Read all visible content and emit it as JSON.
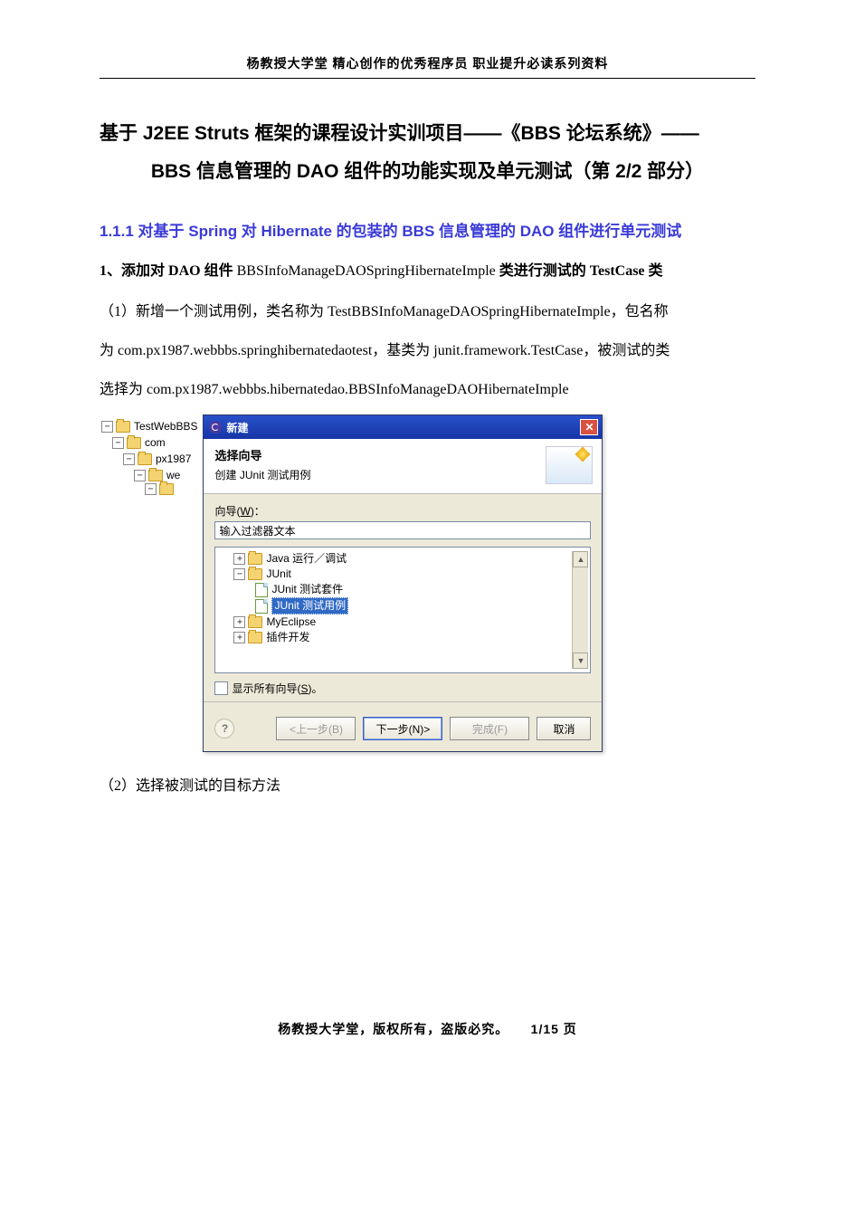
{
  "header": "杨教授大学堂 精心创作的优秀程序员 职业提升必读系列资料",
  "title_line1": "基于 J2EE Struts 框架的课程设计实训项目——《BBS 论坛系统》——",
  "title_line2": "BBS 信息管理的 DAO 组件的功能实现及单元测试（第 2/2 部分）",
  "section_1_1_1": "1.1.1 对基于 Spring 对 Hibernate 的包装的 BBS 信息管理的 DAO 组件进行单元测试",
  "sub1_prefix": "1、添加对 ",
  "sub1_bold1": "DAO",
  "sub1_mid1": " 组件 ",
  "sub1_cls": "BBSInfoManageDAOSpringHibernateImple",
  "sub1_mid2": " 类进行测试的 ",
  "sub1_bold2": "TestCase",
  "sub1_tail": " 类",
  "para1_a": "（1）新增一个测试用例，类名称为 TestBBSInfoManageDAOSpringHibernateImple，包名称",
  "para1_b": "为 com.px1987.webbbs.springhibernatedaotest，基类为 junit.framework.TestCase，被测试的类",
  "para1_c": "选择为 com.px1987.webbbs.hibernatedao.BBSInfoManageDAOHibernateImple",
  "tree": {
    "root": "TestWebBBS",
    "n1": "com",
    "n2": "px1987",
    "n3": "we"
  },
  "dialog": {
    "title": "新建",
    "banner_title": "选择向导",
    "banner_sub": "创建 JUnit 测试用例",
    "wizard_label_pre": "向导(",
    "wizard_label_key": "W",
    "wizard_label_post": ")：",
    "filter_value": "输入过滤器文本",
    "items": {
      "java_run": "Java 运行／调试",
      "junit": "JUnit",
      "junit_suite": "JUnit 测试套件",
      "junit_case": "JUnit 测试用例",
      "myeclipse": "MyEclipse",
      "plugin_dev": "插件开发"
    },
    "show_all_pre": "显示所有向导(",
    "show_all_key": "S",
    "show_all_post": ")。",
    "btn_back": "<上一步(B)",
    "btn_next": "下一步(N)>",
    "btn_finish": "完成(F)",
    "btn_cancel": "取消"
  },
  "para2": "（2）选择被测试的目标方法",
  "footer_text": "杨教授大学堂，版权所有，盗版必究。",
  "footer_page": "1/15 页"
}
